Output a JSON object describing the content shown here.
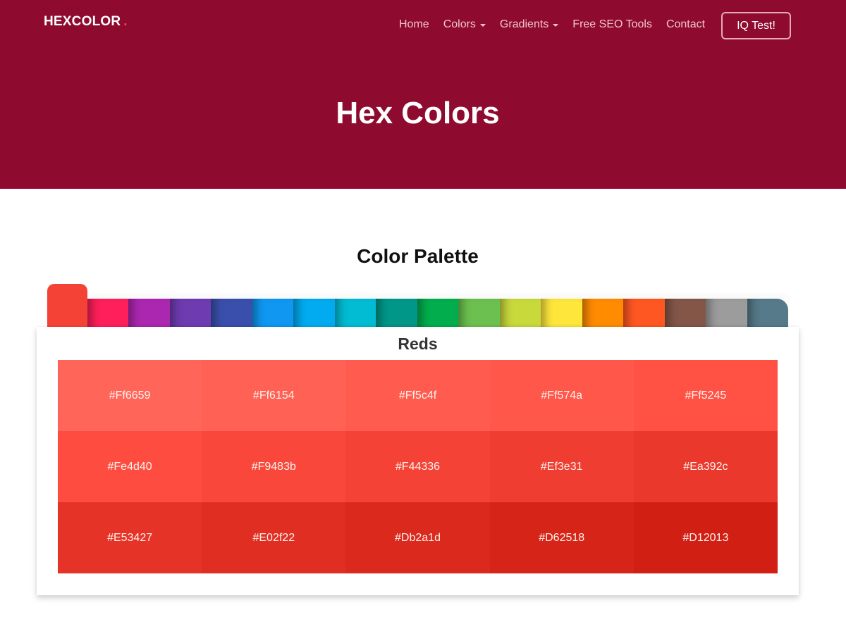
{
  "header": {
    "logo": "HEXCOLOR",
    "logo_dot": ".",
    "nav": [
      {
        "label": "Home",
        "dropdown": false
      },
      {
        "label": "Colors",
        "dropdown": true
      },
      {
        "label": "Gradients",
        "dropdown": true
      },
      {
        "label": "Free SEO Tools",
        "dropdown": false
      },
      {
        "label": "Contact",
        "dropdown": false
      }
    ],
    "cta_label": "IQ Test!",
    "title": "Hex Colors",
    "background": "#8e0a2f"
  },
  "palette": {
    "title": "Color Palette",
    "active_tab": 0,
    "tabs": [
      {
        "name": "red",
        "color": "#f44336"
      },
      {
        "name": "pink",
        "color": "#ff1f5a"
      },
      {
        "name": "purple",
        "color": "#ab27b0"
      },
      {
        "name": "deep-purple",
        "color": "#6f3bb1"
      },
      {
        "name": "indigo",
        "color": "#3a4fab"
      },
      {
        "name": "blue",
        "color": "#0f97f2"
      },
      {
        "name": "light-blue",
        "color": "#02aaef"
      },
      {
        "name": "cyan",
        "color": "#02bcd4"
      },
      {
        "name": "teal",
        "color": "#009688"
      },
      {
        "name": "green",
        "color": "#01ad4c"
      },
      {
        "name": "light-green",
        "color": "#6cc04f"
      },
      {
        "name": "lime",
        "color": "#c8d93b"
      },
      {
        "name": "yellow",
        "color": "#fee63b"
      },
      {
        "name": "orange",
        "color": "#ff8b00"
      },
      {
        "name": "deep-orange",
        "color": "#ff5722"
      },
      {
        "name": "brown",
        "color": "#835648"
      },
      {
        "name": "grey",
        "color": "#9c9c9c"
      },
      {
        "name": "blue-grey",
        "color": "#567a8a"
      }
    ],
    "group_title": "Reds",
    "swatches": [
      "#Ff6659",
      "#Ff6154",
      "#Ff5c4f",
      "#Ff574a",
      "#Ff5245",
      "#Fe4d40",
      "#F9483b",
      "#F44336",
      "#Ef3e31",
      "#Ea392c",
      "#E53427",
      "#E02f22",
      "#Db2a1d",
      "#D62518",
      "#D12013"
    ]
  }
}
